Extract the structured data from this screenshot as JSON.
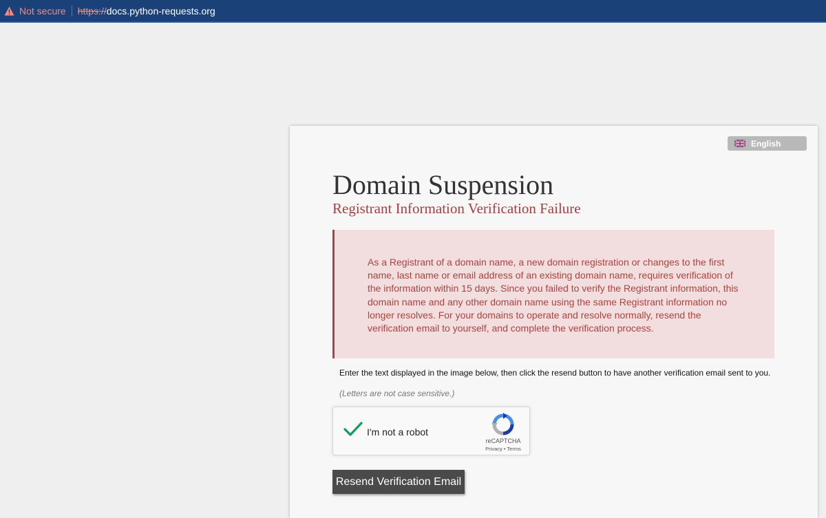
{
  "browser": {
    "security_label": "Not secure",
    "url_scheme": "https://",
    "url_host": "docs.python-requests.org",
    "icons": {
      "warning": "warning-triangle-icon"
    }
  },
  "page": {
    "language_selector": {
      "label": "English",
      "flag": "uk-flag-icon"
    },
    "title": "Domain Suspension",
    "subtitle": "Registrant Information Verification Failure",
    "alert_message": "As a Registrant of a domain name, a new domain registration or changes to the first name, last name or email address of an existing domain name, requires verification of the information within 15 days. Since you failed to verify the Registrant information, this domain name and any other domain name using the same Registrant information no longer resolves. For your domains to operate and resolve normally, resend the verification email to yourself, and complete the verification process.",
    "instructions": "Enter the text displayed in the image below, then click the resend button to have another verification email sent to you.",
    "hint": "(Letters are not case sensitive.)",
    "recaptcha": {
      "label": "I'm not a robot",
      "brand": "reCAPTCHA",
      "links": "Privacy • Terms",
      "checked": true
    },
    "resend_button": "Resend Verification Email"
  },
  "colors": {
    "address_bar": "#1a4278",
    "alert_bg": "#f2dede",
    "alert_text": "#a94442",
    "subtitle": "#a24040",
    "check": "#0f9d58",
    "button": "#4a4a4a"
  }
}
